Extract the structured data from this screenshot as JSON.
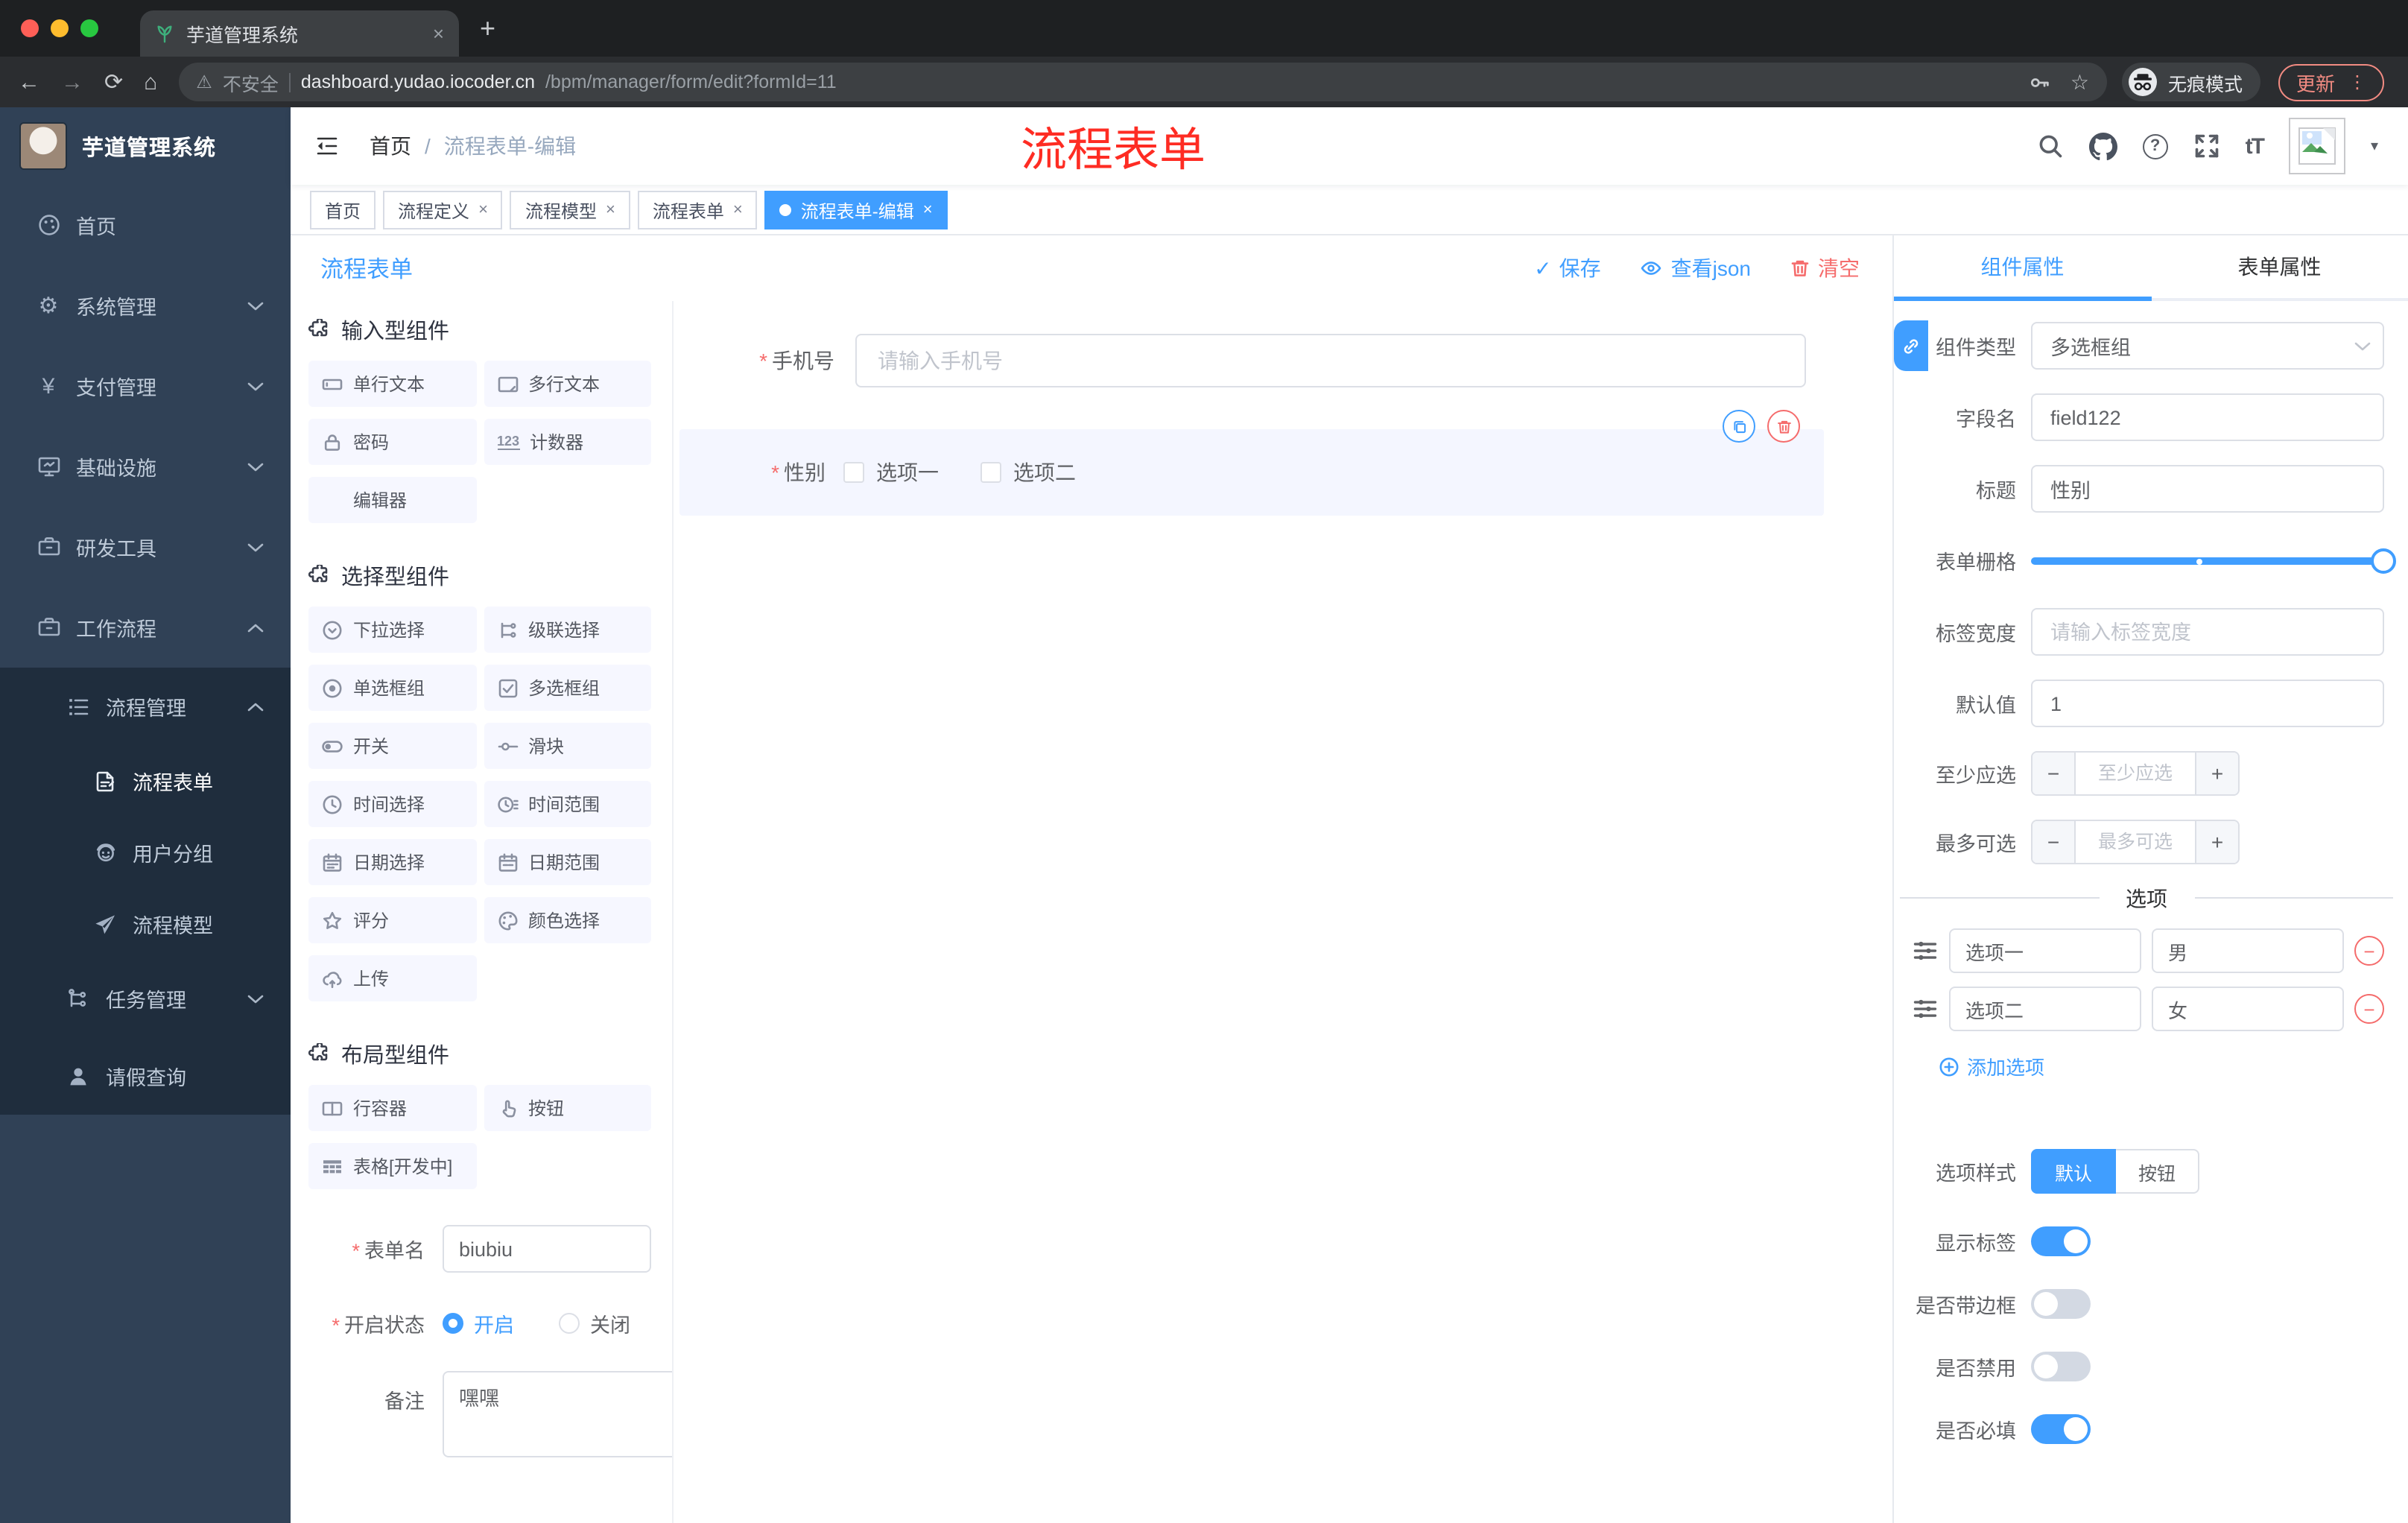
{
  "colors": {
    "accent": "#409eff",
    "danger": "#f56c6c",
    "sidebar": "#304156",
    "sidebar_sub": "#1f2d3d",
    "annotation": "#fe2c23",
    "update_btn": "#f28b82"
  },
  "glyphs": {
    "close": "×",
    "plus": "+",
    "minus": "−",
    "check": "✓",
    "slash": "/",
    "dots": "⋮",
    "caret": "▾",
    "asterisk": "*",
    "question": "?",
    "back": "←",
    "forward": "→",
    "reload": "⟳",
    "home": "⌂",
    "warn": "⚠",
    "star": "☆",
    "gear": "⚙",
    "yen": "¥",
    "font_size": "tT",
    "num123": "123"
  },
  "browser": {
    "tab_title": "芋道管理系统",
    "security": "不安全",
    "url_host": "dashboard.yudao.iocoder.cn",
    "url_path": "/bpm/manager/form/edit?formId=11",
    "incognito": "无痕模式",
    "update": "更新"
  },
  "header": {
    "logo_title": "芋道管理系统",
    "breadcrumb": [
      "首页",
      "流程表单-编辑"
    ],
    "annotation": "流程表单"
  },
  "sidebar": {
    "items": [
      {
        "label": "首页"
      },
      {
        "label": "系统管理"
      },
      {
        "label": "支付管理"
      },
      {
        "label": "基础设施"
      },
      {
        "label": "研发工具"
      },
      {
        "label": "工作流程"
      },
      {
        "label": "流程管理"
      },
      {
        "label": "流程表单"
      },
      {
        "label": "用户分组"
      },
      {
        "label": "流程模型"
      },
      {
        "label": "任务管理"
      },
      {
        "label": "请假查询"
      }
    ]
  },
  "tags": {
    "items": [
      {
        "label": "首页",
        "closable": false,
        "active": false
      },
      {
        "label": "流程定义",
        "closable": true,
        "active": false
      },
      {
        "label": "流程模型",
        "closable": true,
        "active": false
      },
      {
        "label": "流程表单",
        "closable": true,
        "active": false
      },
      {
        "label": "流程表单-编辑",
        "closable": true,
        "active": true
      }
    ]
  },
  "designer": {
    "title": "流程表单",
    "actions": {
      "save": "保存",
      "view_json": "查看json",
      "clear": "清空"
    }
  },
  "palette": {
    "sections": [
      {
        "title": "输入型组件",
        "items": [
          {
            "label": "单行文本",
            "icon": "input-icon"
          },
          {
            "label": "多行文本",
            "icon": "textarea-icon"
          },
          {
            "label": "密码",
            "icon": "lock-icon"
          },
          {
            "label": "计数器",
            "icon": "number-icon"
          },
          {
            "label": "编辑器",
            "icon": "none"
          }
        ]
      },
      {
        "title": "选择型组件",
        "items": [
          {
            "label": "下拉选择",
            "icon": "select-icon"
          },
          {
            "label": "级联选择",
            "icon": "cascader-icon"
          },
          {
            "label": "单选框组",
            "icon": "radio-icon"
          },
          {
            "label": "多选框组",
            "icon": "checkbox-icon"
          },
          {
            "label": "开关",
            "icon": "switch-icon"
          },
          {
            "label": "滑块",
            "icon": "slider-icon"
          },
          {
            "label": "时间选择",
            "icon": "time-icon"
          },
          {
            "label": "时间范围",
            "icon": "time-range-icon"
          },
          {
            "label": "日期选择",
            "icon": "date-icon"
          },
          {
            "label": "日期范围",
            "icon": "date-range-icon"
          },
          {
            "label": "评分",
            "icon": "star-icon"
          },
          {
            "label": "颜色选择",
            "icon": "palette-icon"
          },
          {
            "label": "上传",
            "icon": "upload-icon"
          }
        ]
      },
      {
        "title": "布局型组件",
        "items": [
          {
            "label": "行容器",
            "icon": "row-icon"
          },
          {
            "label": "按钮",
            "icon": "pointer-icon"
          },
          {
            "label": "表格[开发中]",
            "icon": "table-icon"
          }
        ]
      }
    ]
  },
  "form_meta": {
    "name_label": "表单名",
    "name_value": "biubiu",
    "status_label": "开启状态",
    "status_options": [
      {
        "label": "开启",
        "selected": true
      },
      {
        "label": "关闭",
        "selected": false
      }
    ],
    "remark_label": "备注",
    "remark_value": "嘿嘿"
  },
  "canvas": {
    "phone": {
      "label": "手机号",
      "required": true,
      "placeholder": "请输入手机号"
    },
    "gender": {
      "label": "性别",
      "required": true,
      "selected": true,
      "options": [
        "选项一",
        "选项二"
      ]
    }
  },
  "panel": {
    "tabs": [
      {
        "label": "组件属性",
        "active": true
      },
      {
        "label": "表单属性",
        "active": false
      }
    ],
    "component_type": {
      "label": "组件类型",
      "value": "多选框组"
    },
    "field_name": {
      "label": "字段名",
      "value": "field122"
    },
    "title": {
      "label": "标题",
      "value": "性别"
    },
    "grid": {
      "label": "表单栅格"
    },
    "label_width": {
      "label": "标签宽度",
      "placeholder": "请输入标签宽度"
    },
    "default_value": {
      "label": "默认值",
      "value": "1"
    },
    "min_check": {
      "label": "至少应选",
      "placeholder": "至少应选"
    },
    "max_check": {
      "label": "最多可选",
      "placeholder": "最多可选"
    },
    "options_divider": "选项",
    "options": [
      {
        "label": "选项一",
        "value": "男"
      },
      {
        "label": "选项二",
        "value": "女"
      }
    ],
    "add_option": "添加选项",
    "option_style": {
      "label": "选项样式",
      "choices": [
        {
          "label": "默认",
          "active": true
        },
        {
          "label": "按钮",
          "active": false
        }
      ]
    },
    "switches": [
      {
        "label": "显示标签",
        "on": true
      },
      {
        "label": "是否带边框",
        "on": false
      },
      {
        "label": "是否禁用",
        "on": false
      },
      {
        "label": "是否必填",
        "on": true
      }
    ]
  }
}
